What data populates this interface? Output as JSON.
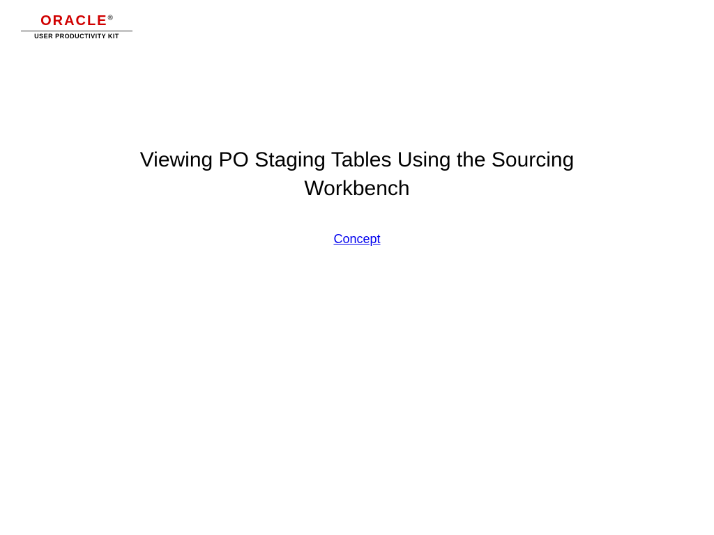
{
  "logo": {
    "brand": "ORACLE",
    "reg": "®",
    "subtitle": "USER PRODUCTIVITY KIT"
  },
  "main": {
    "title": "Viewing PO Staging Tables Using the Sourcing Workbench",
    "link_label": "Concept"
  }
}
